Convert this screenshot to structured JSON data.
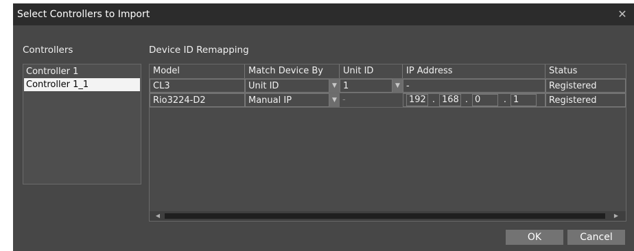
{
  "dialog": {
    "title": "Select Controllers to Import",
    "close_glyph": "✕"
  },
  "controllers": {
    "label": "Controllers",
    "items": [
      "Controller 1",
      "Controller 1_1"
    ],
    "selected_index": 1
  },
  "remap": {
    "label": "Device ID Remapping",
    "columns": [
      "Model",
      "Match Device By",
      "Unit ID",
      "IP Address",
      "Status"
    ],
    "rows": [
      {
        "model": "CL3",
        "match_by": "Unit ID",
        "unit_id": "1",
        "ip": "-",
        "status": "Registered"
      },
      {
        "model": "Rio3224-D2",
        "match_by": "Manual IP",
        "unit_id": "-",
        "ip_octets": [
          "192",
          "168",
          "0",
          "1"
        ],
        "ip_dot": ".",
        "status": "Registered"
      }
    ]
  },
  "icons": {
    "dropdown": "▼",
    "scroll_left": "◀",
    "scroll_right": "▶"
  },
  "buttons": {
    "ok": "OK",
    "cancel": "Cancel"
  },
  "colors": {
    "titlebar": "#2c2c2c",
    "background": "#474747",
    "selection": "#f3f3f3",
    "button": "#737373"
  }
}
